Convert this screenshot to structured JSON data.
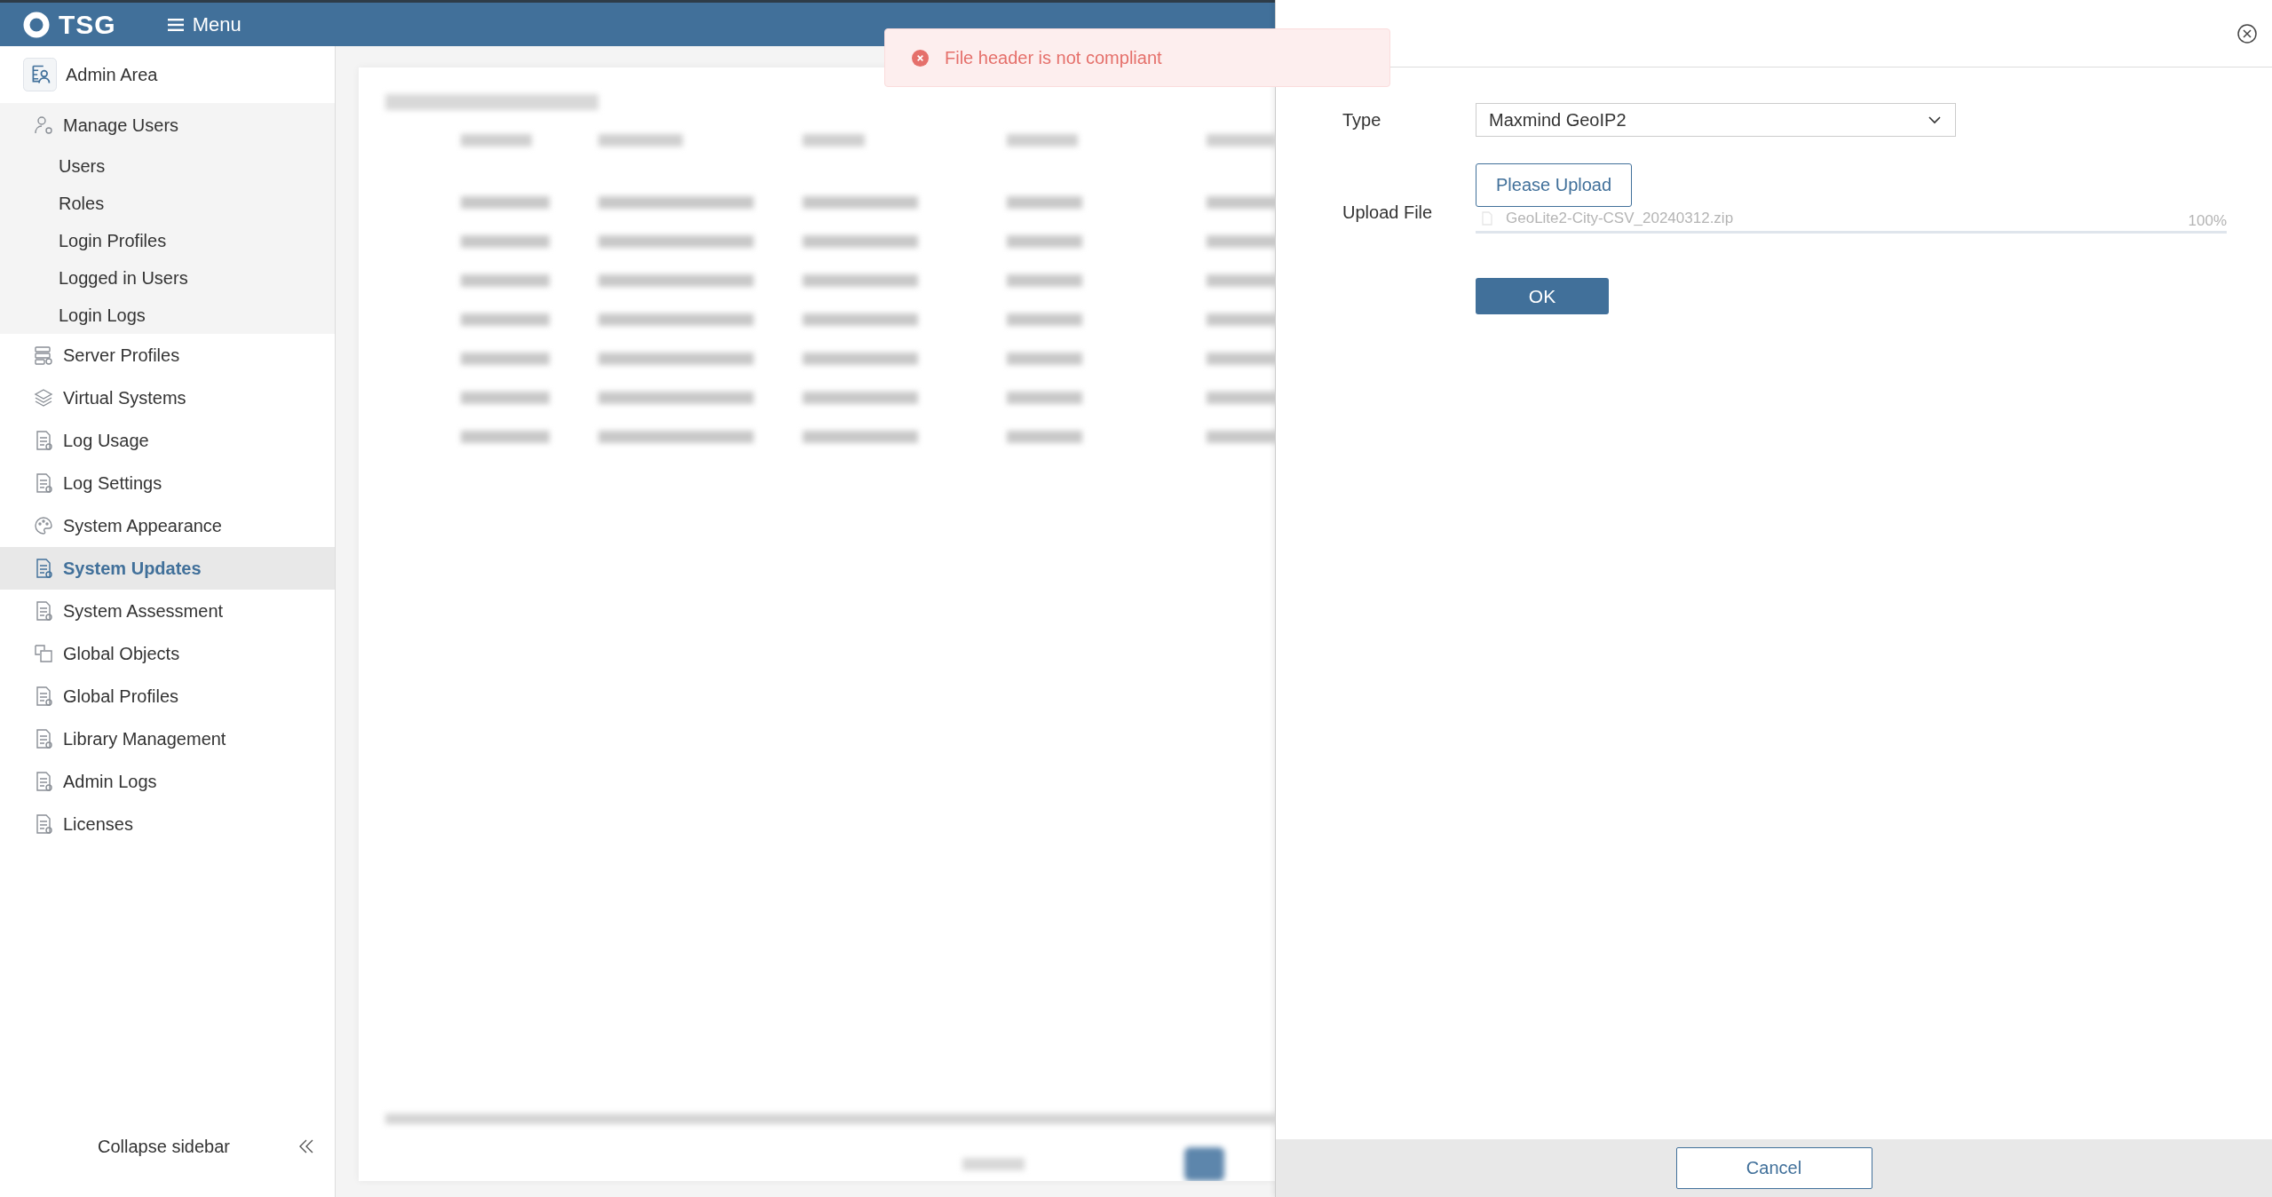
{
  "header": {
    "logo": "TSG",
    "menu": "Menu"
  },
  "sidebar": {
    "title": "Admin Area",
    "items": [
      {
        "label": "Manage Users",
        "selected": false,
        "expanded": true,
        "children": [
          {
            "label": "Users",
            "selected": false
          },
          {
            "label": "Roles",
            "selected": false
          },
          {
            "label": "Login Profiles",
            "selected": false
          },
          {
            "label": "Logged in Users",
            "selected": false
          },
          {
            "label": "Login Logs",
            "selected": false
          }
        ]
      },
      {
        "label": "Server Profiles",
        "selected": false
      },
      {
        "label": "Virtual Systems",
        "selected": false
      },
      {
        "label": "Log Usage",
        "selected": false
      },
      {
        "label": "Log Settings",
        "selected": false
      },
      {
        "label": "System Appearance",
        "selected": false
      },
      {
        "label": "System Updates",
        "selected": true
      },
      {
        "label": "System Assessment",
        "selected": false
      },
      {
        "label": "Global Objects",
        "selected": false
      },
      {
        "label": "Global Profiles",
        "selected": false
      },
      {
        "label": "Library Management",
        "selected": false
      },
      {
        "label": "Admin Logs",
        "selected": false
      },
      {
        "label": "Licenses",
        "selected": false
      }
    ],
    "collapse": "Collapse sidebar"
  },
  "toast": {
    "kind": "error",
    "message": "File header is not compliant"
  },
  "drawer": {
    "type_label": "Type",
    "type_value": "Maxmind GeoIP2",
    "upload_label": "Upload File",
    "upload_button": "Please Upload",
    "file": {
      "name": "GeoLite2-City-CSV_20240312.zip",
      "level": 1,
      "reading": "100%"
    },
    "ok": "OK",
    "cancel": "Cancel"
  }
}
